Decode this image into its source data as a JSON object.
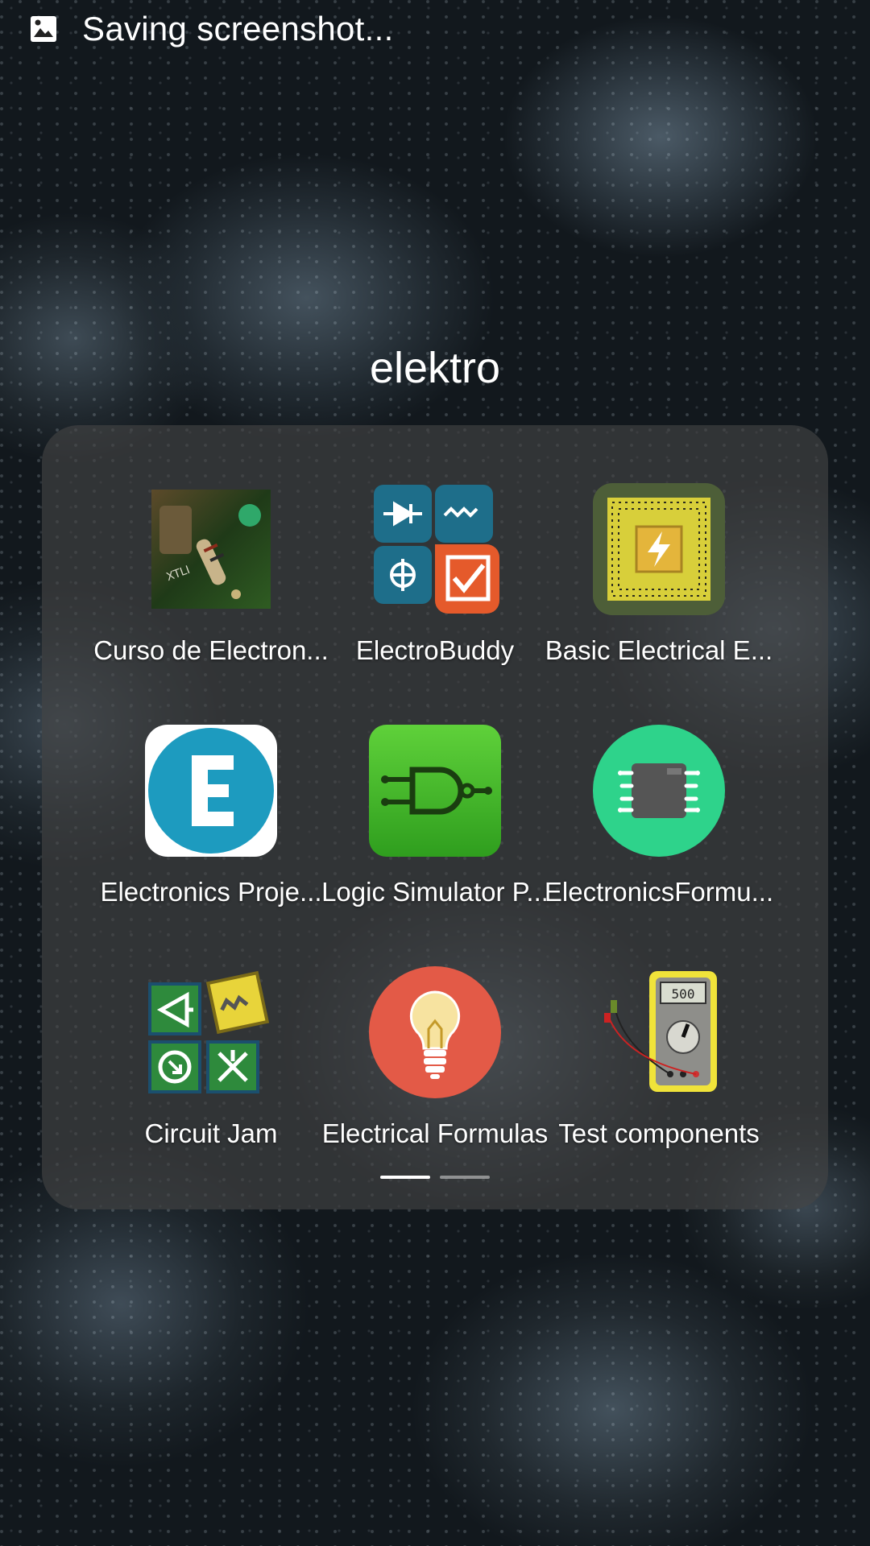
{
  "status_bar": {
    "notification_icon": "image-icon",
    "notification_text": "Saving screenshot..."
  },
  "folder": {
    "title": "elektro",
    "apps": [
      {
        "label": "Curso de Electron...",
        "icon": "circuit-board-photo-icon"
      },
      {
        "label": "ElectroBuddy",
        "icon": "electrobuddy-icon"
      },
      {
        "label": "Basic Electrical E...",
        "icon": "chip-lightning-icon"
      },
      {
        "label": "Electronics Proje...",
        "icon": "letter-e-circle-icon"
      },
      {
        "label": "Logic Simulator P...",
        "icon": "nand-gate-icon"
      },
      {
        "label": "ElectronicsFormu...",
        "icon": "microchip-circle-icon"
      },
      {
        "label": "Circuit Jam",
        "icon": "circuit-jam-tiles-icon"
      },
      {
        "label": "Electrical Formulas",
        "icon": "lightbulb-icon"
      },
      {
        "label": "Test components",
        "icon": "multimeter-icon"
      }
    ],
    "pages": {
      "total": 2,
      "current": 1
    }
  },
  "colors": {
    "folder_panel": "#464646",
    "text": "#ffffff"
  }
}
